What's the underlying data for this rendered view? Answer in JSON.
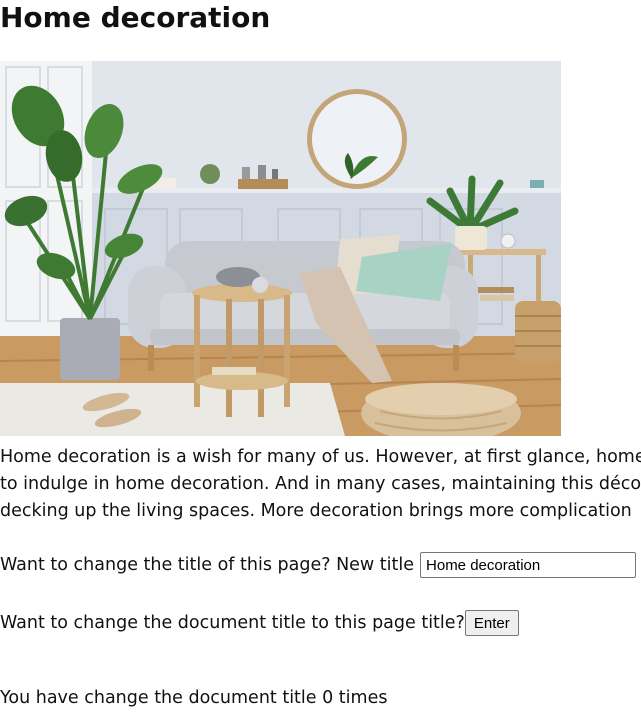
{
  "page": {
    "title": "Home decoration"
  },
  "hero_image": {
    "description_icon": "living-room-photo"
  },
  "intro": {
    "lines": [
      "Home decoration is a wish for many of us. However, at first glance, home",
      "to indulge in home decoration. And in many cases, maintaining this déco",
      "decking up the living spaces. More decoration brings more complication"
    ]
  },
  "title_form": {
    "prompt": "Want to change the title of this page? New title",
    "input_value": "Home decoration"
  },
  "doc_form": {
    "prompt": "Want to change the document title to this page title?",
    "button_label": "Enter"
  },
  "counter": {
    "text": "You have change the document title 0 times"
  },
  "colors": {
    "wall": "#dfe3ea",
    "floor": "#c99a62",
    "sofa": "#c9ccd1",
    "plant": "#3f7a32"
  }
}
